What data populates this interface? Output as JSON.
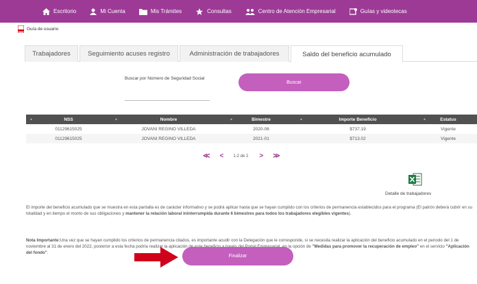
{
  "nav": {
    "items": [
      {
        "label": "Escritorio",
        "icon": "home-icon"
      },
      {
        "label": "Mi Cuenta",
        "icon": "user-icon"
      },
      {
        "label": "Mis Trámites",
        "icon": "folder-icon"
      },
      {
        "label": "Consultas",
        "icon": "star-icon"
      },
      {
        "label": "Centro de Atención Empresarial",
        "icon": "people-icon"
      },
      {
        "label": "Guías y videotecas",
        "icon": "guide-icon"
      }
    ]
  },
  "guide": {
    "label": "Guía de usuario",
    "icon": "pdf-icon"
  },
  "tabs": [
    {
      "label": "Trabajadores"
    },
    {
      "label": "Seguimiento acuses registro"
    },
    {
      "label": "Administración de trabajadores"
    },
    {
      "label": "Saldo del beneficio acumulado",
      "active": true
    }
  ],
  "search": {
    "label": "Buscar por Número de Seguridad Social",
    "value": "",
    "button": "Buscar"
  },
  "table": {
    "headers": [
      "NSS",
      "Nombre",
      "Bimestre",
      "Importe Beneficio",
      "Estatus"
    ],
    "rows": [
      [
        "01129615025",
        "JOVANI REGINO VILLEDA",
        "2020-06",
        "$737.19",
        "Vigente"
      ],
      [
        "01129615025",
        "JOVANI REGINO VILLEDA",
        "2021-01",
        "$713.02",
        "Vigente"
      ]
    ]
  },
  "pager": {
    "first": "≪",
    "prev": "<",
    "text": "1-2 de 2",
    "next": ">",
    "last": "≫"
  },
  "export": {
    "label": "Detalle de trabajadores",
    "icon": "excel-icon"
  },
  "info": {
    "p1_a": "El importe del beneficio acumulado que se muestra en esta pantalla es de carácter informativo y se podrá aplicar hasta que se hayan cumplido con los criterios de permanencia establecidos para el programa (El patrón deberá cubrir en su totalidad y en tiempo el monto de sus obligaciones y ",
    "p1_b": "mantener la relación laboral ininterrumpida durante 6 bimestres para todos los trabajadores elegibles vigentes",
    "p1_c": ").",
    "p2_a": "Nota Importante:",
    "p2_b": "Una vez que se hayan cumplido los criterios de permanencia citados, es importante acudir con la Delegación que le corresponde, si se necesita realizar la aplicación del beneficio acumulado en el periodo del 1 de noviembre al 31 de enero del 2022, posterior a esta fecha podría realizar la aplicación de este beneficio a través del Portal Empresarial, en la opción de ",
    "p2_c": "\"Medidas para promover la recuperación de empleo\"",
    "p2_d": " en el servicio ",
    "p2_e": "\"Aplicación del fondo\"",
    "p2_f": "."
  },
  "finalizar": "Finalizar",
  "colors": {
    "brand": "#9c3a96",
    "button": "#c45fbe",
    "arrow": "#d0021b",
    "excel": "#1f7a44"
  }
}
